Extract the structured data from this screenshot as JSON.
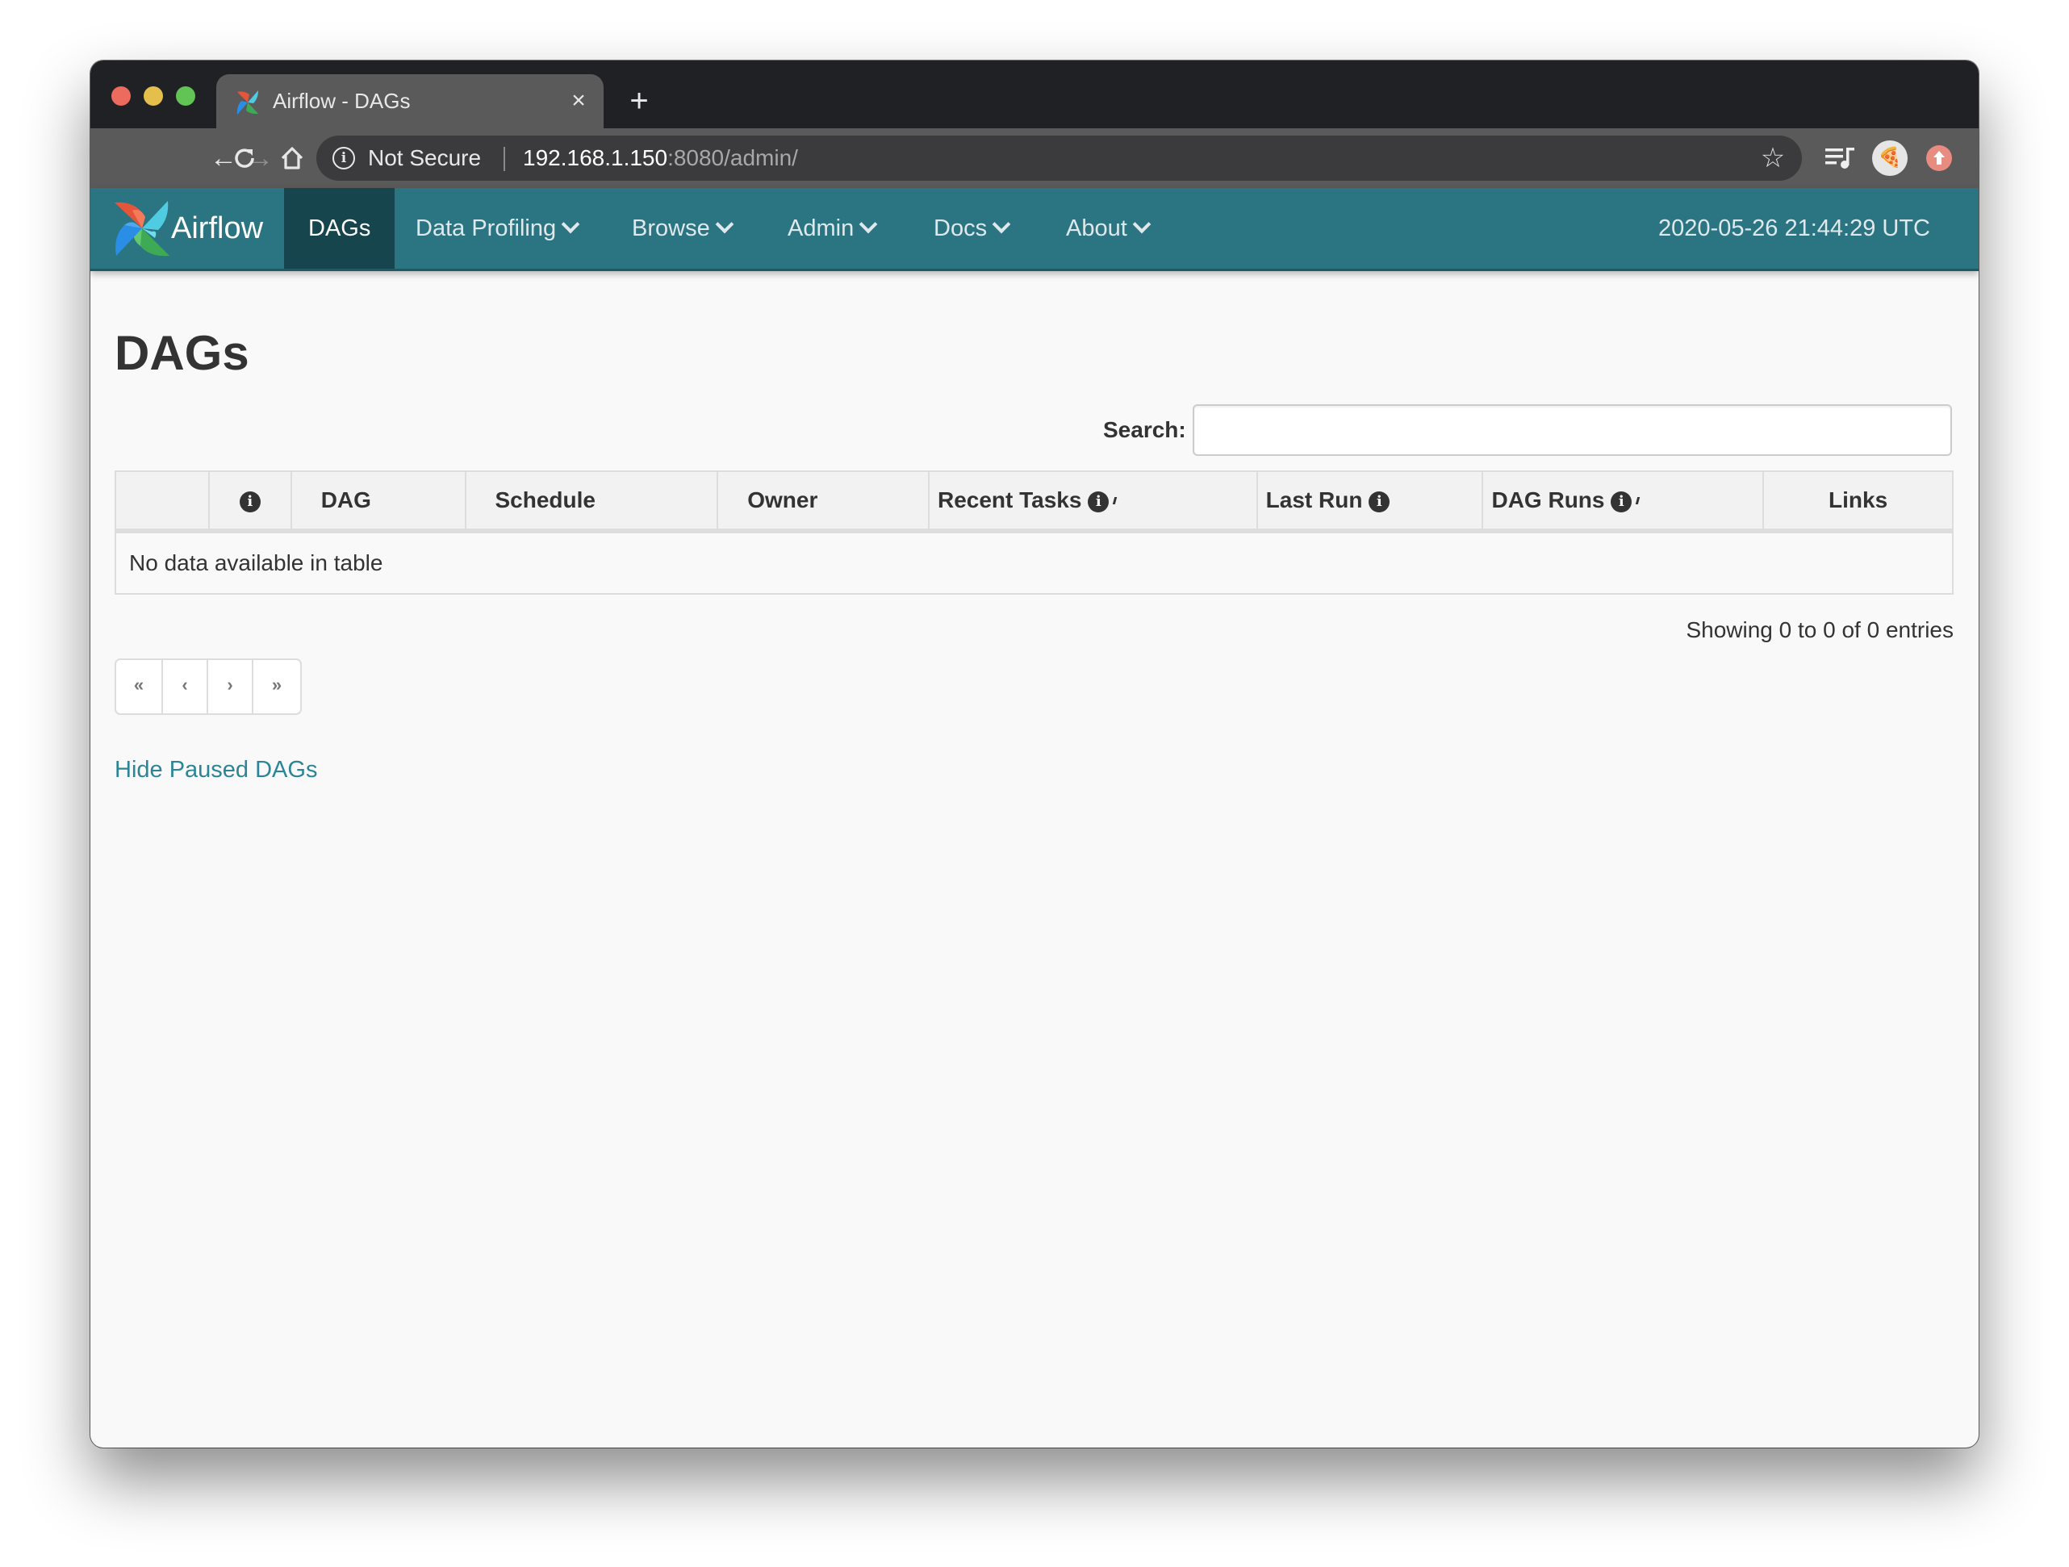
{
  "browser": {
    "tab": {
      "title": "Airflow - DAGs",
      "favicon": "airflow-pinwheel-icon",
      "close_glyph": "×"
    },
    "new_tab_glyph": "+",
    "toolbar": {
      "back_glyph": "←",
      "forward_glyph": "→",
      "reload_glyph": "↻",
      "home_glyph": "⌂",
      "security_label": "Not Secure",
      "url_host": "192.168.1.150",
      "url_rest": ":8080/admin/",
      "bookmark_glyph": "☆",
      "profile_glyph": "🍕"
    }
  },
  "navbar": {
    "brand": "Airflow",
    "items": [
      {
        "label": "DAGs",
        "active": true,
        "dropdown": false
      },
      {
        "label": "Data Profiling",
        "active": false,
        "dropdown": true
      },
      {
        "label": "Browse",
        "active": false,
        "dropdown": true
      },
      {
        "label": "Admin",
        "active": false,
        "dropdown": true
      },
      {
        "label": "Docs",
        "active": false,
        "dropdown": true
      },
      {
        "label": "About",
        "active": false,
        "dropdown": true
      }
    ],
    "timestamp": "2020-05-26 21:44:29 UTC",
    "color": "#2b7482",
    "active_color": "#17454d"
  },
  "main": {
    "title": "DAGs",
    "search": {
      "label": "Search:",
      "value": "",
      "placeholder": ""
    },
    "table": {
      "columns": [
        {
          "label": "",
          "info": false
        },
        {
          "label": "",
          "info": true
        },
        {
          "label": "DAG",
          "info": false
        },
        {
          "label": "Schedule",
          "info": false
        },
        {
          "label": "Owner",
          "info": false
        },
        {
          "label": "Recent Tasks",
          "info": true
        },
        {
          "label": "Last Run",
          "info": true
        },
        {
          "label": "DAG Runs",
          "info": true
        },
        {
          "label": "Links",
          "info": false
        }
      ],
      "rows": [],
      "empty_message": "No data available in table"
    },
    "info_glyph": "i",
    "summary": "Showing 0 to 0 of 0 entries",
    "pagination": {
      "first": "«",
      "prev": "‹",
      "next": "›",
      "last": "»"
    },
    "hide_paused_link": "Hide Paused DAGs",
    "link_color": "#2b8596"
  }
}
